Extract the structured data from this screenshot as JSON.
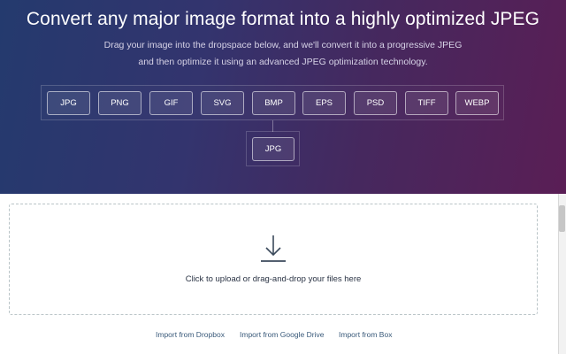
{
  "hero": {
    "title": "Convert any major image format into a highly optimized JPEG",
    "subtitle_line1": "Drag your image into the dropspace below, and we'll convert it into a progressive JPEG",
    "subtitle_line2": "and then optimize it using an advanced JPEG optimization technology.",
    "colors": {
      "gradient_start": "#243a6e",
      "gradient_end": "#5a1e55"
    }
  },
  "formats": [
    "JPG",
    "PNG",
    "GIF",
    "SVG",
    "BMP",
    "EPS",
    "PSD",
    "TIFF",
    "WEBP"
  ],
  "output_format": "JPG",
  "dropzone": {
    "icon": "download-icon",
    "text": "Click to upload or drag-and-drop your files here"
  },
  "imports": {
    "dropbox": "Import from Dropbox",
    "google_drive": "Import from Google Drive",
    "box": "Import from Box"
  }
}
